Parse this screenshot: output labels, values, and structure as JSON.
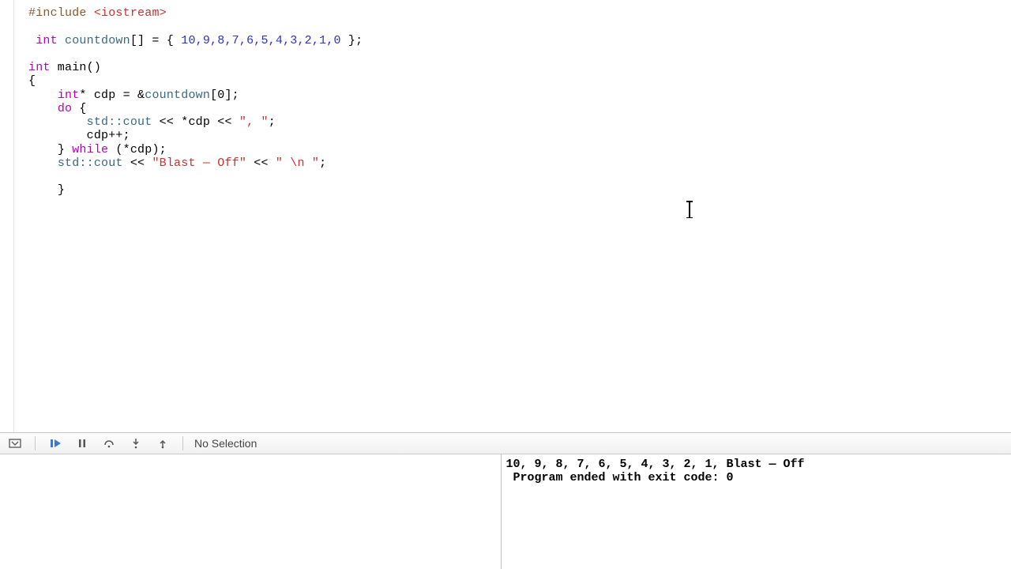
{
  "code": {
    "l1": {
      "pre": "#include",
      "inc": " <iostream>"
    },
    "l2": {},
    "l3": {
      "pad": " ",
      "kw": "int",
      "id": " countdown",
      "arr": "[] = { ",
      "nums": "10,9,8,7,6,5,4,3,2,1,0",
      "end": " };"
    },
    "l4": {},
    "l5": {
      "kw": "int",
      "fn": " main()"
    },
    "l6": {
      "brace": "{"
    },
    "l7": {
      "pad": "    ",
      "kw": "int",
      "ptr": "* cdp = &",
      "id": "countdown",
      "rest": "[0];"
    },
    "l8": {
      "pad": "    ",
      "kw": "do",
      "rest": " {"
    },
    "l9": {
      "pad": "        ",
      "ns": "std::",
      "id": "cout",
      "op1": " << *cdp << ",
      "str": "\", \"",
      "end": ";"
    },
    "l10": {
      "pad": "        ",
      "txt": "cdp++;"
    },
    "l11": {
      "pad": "    ",
      "brace": "} ",
      "kw": "while",
      "rest": " (*cdp);"
    },
    "l12": {
      "pad": "    ",
      "ns": "std::",
      "id": "cout",
      "op1": " << ",
      "str1": "\"Blast — Off\"",
      "op2": " << ",
      "str2": "\" \\n \"",
      "end": ";"
    },
    "l13": {},
    "l14": {
      "pad": "    ",
      "brace": "}"
    }
  },
  "toolbar": {
    "status": "No Selection"
  },
  "console": {
    "line1": "10, 9, 8, 7, 6, 5, 4, 3, 2, 1, Blast — Off",
    "line2": " Program ended with exit code: 0"
  }
}
